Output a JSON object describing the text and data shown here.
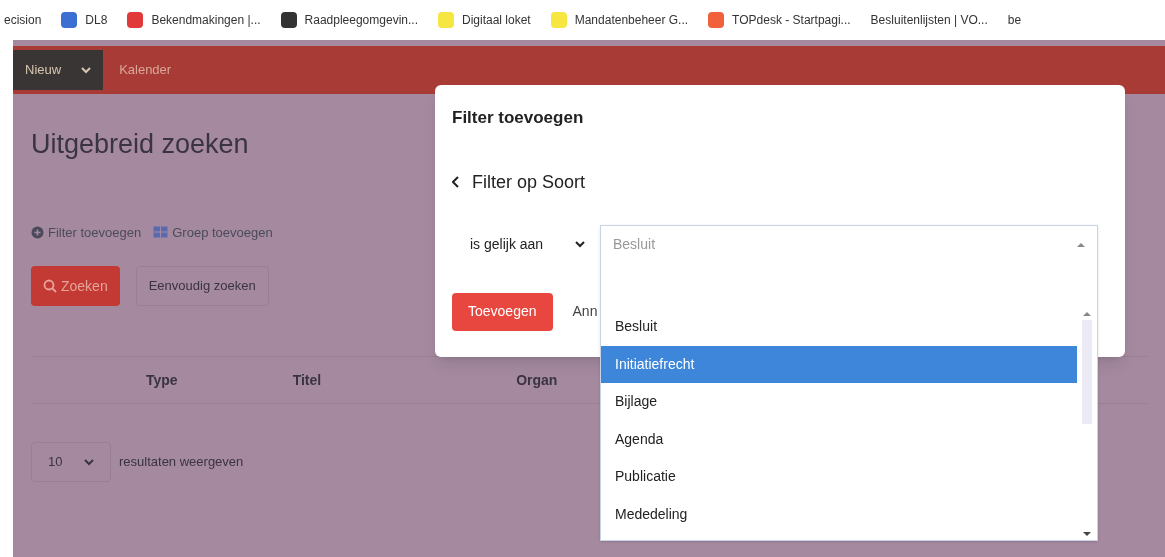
{
  "bookmarks": [
    {
      "label": "ecision"
    },
    {
      "label": "DL8",
      "color": "#3b6fd1"
    },
    {
      "label": "Bekendmakingen |...",
      "color": "#e03a3a"
    },
    {
      "label": "Raadpleegomgevin...",
      "color": "#333333"
    },
    {
      "label": "Digitaal loket",
      "color": "#f5e642"
    },
    {
      "label": "Mandatenbeheer G...",
      "color": "#f5e642"
    },
    {
      "label": "TOPdesk - Startpagi...",
      "color": "#f0603a"
    },
    {
      "label": "Besluitenlijsten | VO..."
    },
    {
      "label": "be"
    }
  ],
  "navbar": {
    "new_button": "Nieuw",
    "links": [
      "Kalender"
    ]
  },
  "page": {
    "title": "Uitgebreid zoeken",
    "actions": [
      "Filter toevoegen",
      "Groep toevoegen"
    ],
    "search_button": "Zoeken",
    "simple_search_button": "Eenvoudig zoeken",
    "table": {
      "columns": [
        "Type",
        "Titel",
        "Organ"
      ]
    },
    "page_size": {
      "value": "10",
      "label": "resultaten weergeven"
    }
  },
  "modal": {
    "title": "Filter toevoegen",
    "back_label": "Filter op Soort",
    "operator": "is gelijk aan",
    "add_button": "Toevoegen",
    "cancel_button": "Ann"
  },
  "dropdown": {
    "placeholder": "Besluit",
    "options": [
      {
        "label": "Besluit",
        "selected": false
      },
      {
        "label": "Initiatiefrecht",
        "selected": true
      },
      {
        "label": "Bijlage",
        "selected": false
      },
      {
        "label": "Agenda",
        "selected": false
      },
      {
        "label": "Publicatie",
        "selected": false
      },
      {
        "label": "Mededeling",
        "selected": false
      }
    ]
  }
}
